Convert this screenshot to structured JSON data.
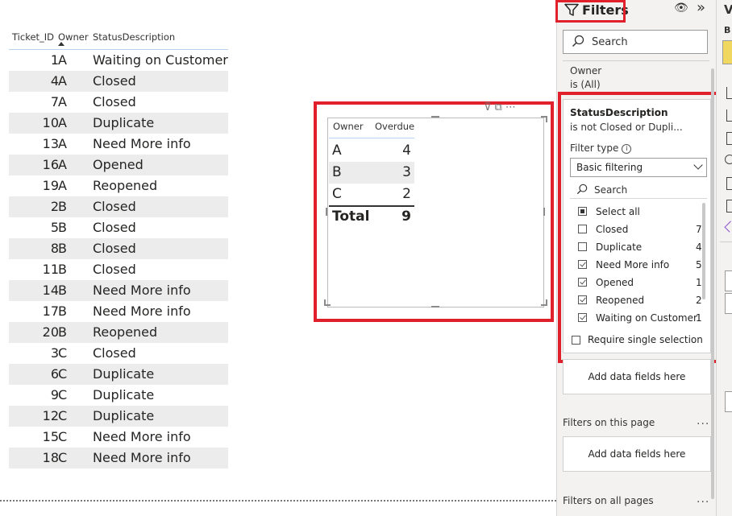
{
  "ticket_table": {
    "headers": {
      "id": "Ticket_ID",
      "owner": "Owner",
      "status": "StatusDescription"
    },
    "rows": [
      {
        "id": "1",
        "owner": "A",
        "status": "Waiting on Customer"
      },
      {
        "id": "4",
        "owner": "A",
        "status": "Closed"
      },
      {
        "id": "7",
        "owner": "A",
        "status": "Closed"
      },
      {
        "id": "10",
        "owner": "A",
        "status": "Duplicate"
      },
      {
        "id": "13",
        "owner": "A",
        "status": "Need More info"
      },
      {
        "id": "16",
        "owner": "A",
        "status": "Opened"
      },
      {
        "id": "19",
        "owner": "A",
        "status": "Reopened"
      },
      {
        "id": "2",
        "owner": "B",
        "status": "Closed"
      },
      {
        "id": "5",
        "owner": "B",
        "status": "Closed"
      },
      {
        "id": "8",
        "owner": "B",
        "status": "Closed"
      },
      {
        "id": "11",
        "owner": "B",
        "status": "Closed"
      },
      {
        "id": "14",
        "owner": "B",
        "status": "Need More info"
      },
      {
        "id": "17",
        "owner": "B",
        "status": "Need More info"
      },
      {
        "id": "20",
        "owner": "B",
        "status": "Reopened"
      },
      {
        "id": "3",
        "owner": "C",
        "status": "Closed"
      },
      {
        "id": "6",
        "owner": "C",
        "status": "Duplicate"
      },
      {
        "id": "9",
        "owner": "C",
        "status": "Duplicate"
      },
      {
        "id": "12",
        "owner": "C",
        "status": "Duplicate"
      },
      {
        "id": "15",
        "owner": "C",
        "status": "Need More info"
      },
      {
        "id": "18",
        "owner": "C",
        "status": "Need More info"
      }
    ]
  },
  "matrix": {
    "headers": {
      "owner": "Owner",
      "value": "Overdue"
    },
    "rows": [
      {
        "owner": "A",
        "value": "4"
      },
      {
        "owner": "B",
        "value": "3"
      },
      {
        "owner": "C",
        "value": "2"
      }
    ],
    "total": {
      "label": "Total",
      "value": "9"
    }
  },
  "filters": {
    "title": "Filters",
    "search_placeholder": "Search",
    "owner_filter": {
      "field": "Owner",
      "state": "is (All)"
    },
    "status_filter": {
      "field": "StatusDescription",
      "state": "is not Closed or Dupli...",
      "filter_type_label": "Filter type",
      "filter_type_value": "Basic filtering",
      "search_placeholder": "Search",
      "items": [
        {
          "label": "Select all",
          "count": "",
          "state": "partial"
        },
        {
          "label": "Closed",
          "count": "7",
          "state": "unchecked"
        },
        {
          "label": "Duplicate",
          "count": "4",
          "state": "unchecked"
        },
        {
          "label": "Need More info",
          "count": "5",
          "state": "checked"
        },
        {
          "label": "Opened",
          "count": "1",
          "state": "checked"
        },
        {
          "label": "Reopened",
          "count": "2",
          "state": "checked"
        },
        {
          "label": "Waiting on Customer",
          "count": "1",
          "state": "checked"
        }
      ],
      "require_single": "Require single selection"
    },
    "add_fields_visual": "Add data fields here",
    "page_section": "Filters on this page",
    "add_fields_page": "Add data fields here",
    "all_pages_section": "Filters on all pages",
    "more": "..."
  },
  "viz_pane": {
    "title": "V",
    "b": "B"
  },
  "colors": {
    "highlight": "#e0202a",
    "row_band": "#ececec",
    "pane_bg": "#f3f2f1"
  }
}
